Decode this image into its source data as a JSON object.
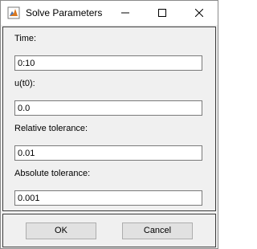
{
  "window": {
    "title": "Solve Parameters",
    "icon": "matlab-figure-icon",
    "controls": [
      "minimize-icon",
      "maximize-icon",
      "close-icon"
    ]
  },
  "fields": [
    {
      "label": "Time:",
      "value": "0:10"
    },
    {
      "label": "u(t0):",
      "value": "0.0"
    },
    {
      "label": "Relative tolerance:",
      "value": "0.01"
    },
    {
      "label": "Absolute tolerance:",
      "value": "0.001"
    }
  ],
  "buttons": {
    "ok_label": "OK",
    "cancel_label": "Cancel"
  }
}
